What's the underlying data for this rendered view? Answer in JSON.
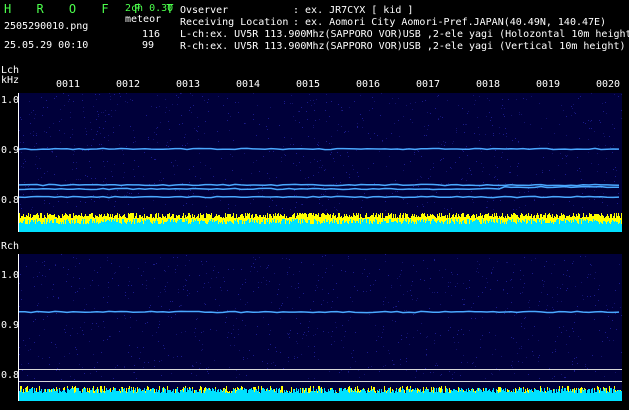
{
  "header": {
    "logo": "H R O F F T",
    "version": "2ch 0.30",
    "filename": "2505290010.png",
    "mode": "meteor",
    "datetime": "25.05.29 00:10",
    "lch_count": "116",
    "rch_count": "99",
    "observer_label": "Ovserver",
    "observer_value": ": ex. JR7CYX [ kid ]",
    "location_label": "Receiving Location",
    "location_value": ": ex. Aomori City Aomori-Pref.JAPAN(40.49N, 140.47E)",
    "lch_info": "L-ch:ex. UV5R 113.900Mhz(SAPPORO VOR)USB ,2-ele yagi (Holozontal 10m height",
    "rch_info": "R-ch:ex. UV5R 113.900Mhz(SAPPORO VOR)USB ,2-ele yagi (Vertical 10m height)"
  },
  "lch": {
    "label": "Lch",
    "unit": "kHz",
    "y_ticks": [
      "1.0",
      "0.9",
      "0.8"
    ],
    "x_ticks": [
      "0011",
      "0012",
      "0013",
      "0014",
      "0015",
      "0016",
      "0017",
      "0018",
      "0019",
      "0020"
    ]
  },
  "rch": {
    "label": "Rch",
    "y_ticks": [
      "1.0",
      "0.9",
      "0.8"
    ]
  },
  "colors": {
    "background": "#000000",
    "waterfall": "#00003a",
    "carrier": "#4aa8ff",
    "level_yellow": "#ffff00",
    "level_cyan": "#00e0ff",
    "text_white": "#ffffff",
    "text_green": "#4cff4c"
  }
}
